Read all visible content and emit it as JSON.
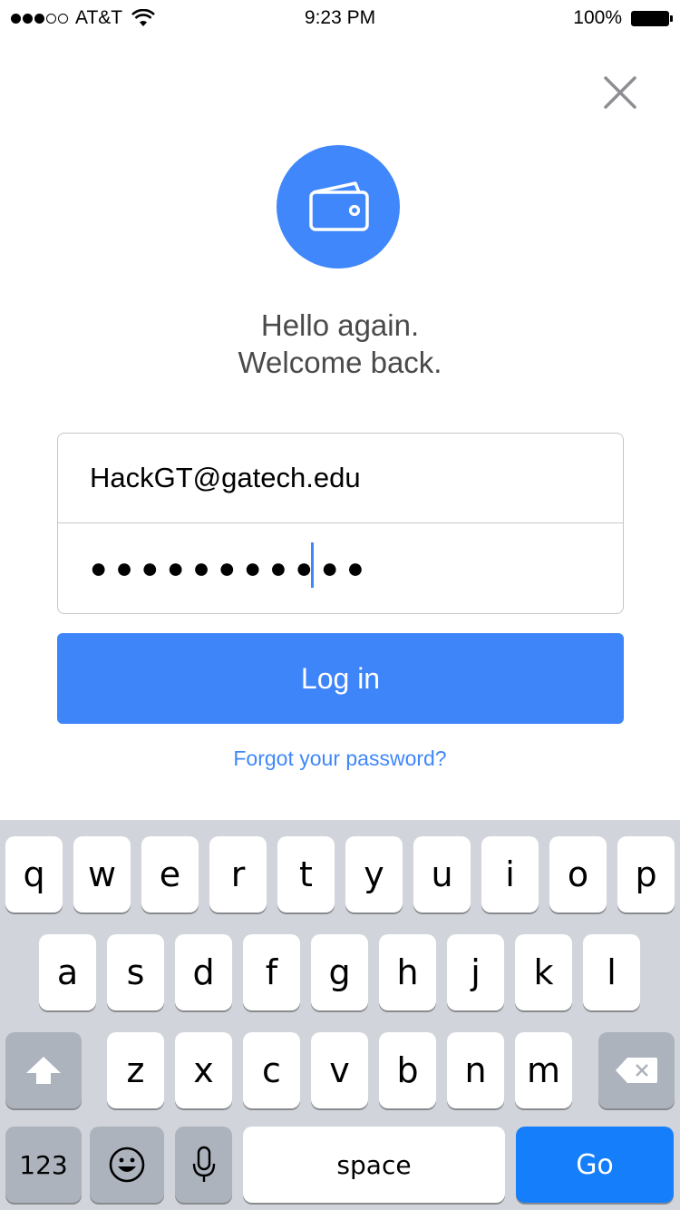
{
  "status_bar": {
    "carrier": "AT&T",
    "time": "9:23 PM",
    "battery": "100%",
    "signal_bars_filled": 3,
    "signal_bars_total": 5
  },
  "icons": {
    "close": "close-icon",
    "logo": "wallet-icon"
  },
  "greeting": {
    "line1": "Hello again.",
    "line2": "Welcome back."
  },
  "form": {
    "email_value": "HackGT@gatech.edu",
    "password_mask": "●●●●●●●●●●●"
  },
  "login_button": {
    "label": "Log in"
  },
  "forgot_link": {
    "label": "Forgot your password?"
  },
  "keyboard": {
    "row1": [
      "q",
      "w",
      "e",
      "r",
      "t",
      "y",
      "u",
      "i",
      "o",
      "p"
    ],
    "row2": [
      "a",
      "s",
      "d",
      "f",
      "g",
      "h",
      "j",
      "k",
      "l"
    ],
    "row3": [
      "z",
      "x",
      "c",
      "v",
      "b",
      "n",
      "m"
    ],
    "numbers_label": "123",
    "space_label": "space",
    "go_label": "Go"
  },
  "colors": {
    "accent": "#3f87fa",
    "go_key": "#147efb",
    "text_gray": "#4a4a4a"
  }
}
